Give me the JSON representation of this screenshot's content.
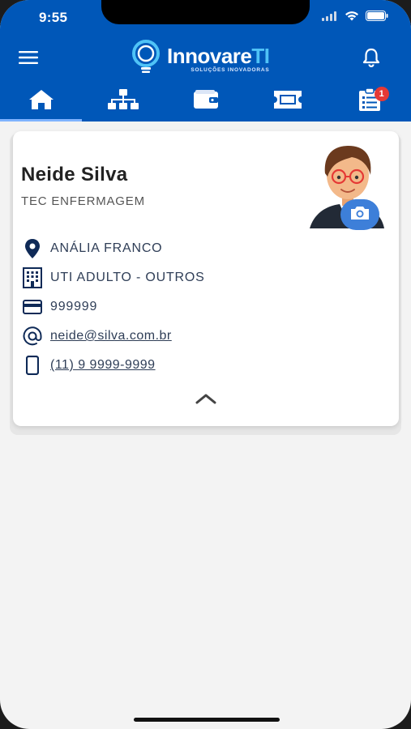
{
  "status_bar": {
    "time": "9:55"
  },
  "header": {
    "logo_main": "Innovare",
    "logo_accent": "TI",
    "logo_tagline": "SOLUÇÕES INOVADORAS"
  },
  "tabs": [
    {
      "icon": "home-icon",
      "active": true
    },
    {
      "icon": "org-chart-icon",
      "active": false
    },
    {
      "icon": "wallet-icon",
      "active": false
    },
    {
      "icon": "ticket-icon",
      "active": false
    },
    {
      "icon": "clipboard-list-icon",
      "active": false,
      "badge": "1"
    }
  ],
  "profile": {
    "name": "Neide Silva",
    "role": "TEC ENFERMAGEM",
    "location": "ANÁLIA FRANCO",
    "department": "UTI ADULTO - OUTROS",
    "id_number": "999999",
    "email": "neide@silva.com.br",
    "phone": "(11) 9 9999-9999"
  },
  "colors": {
    "header_bg": "#0057b8",
    "accent": "#4fc3f7",
    "badge": "#e53935",
    "text_dark": "#2f3e57"
  }
}
